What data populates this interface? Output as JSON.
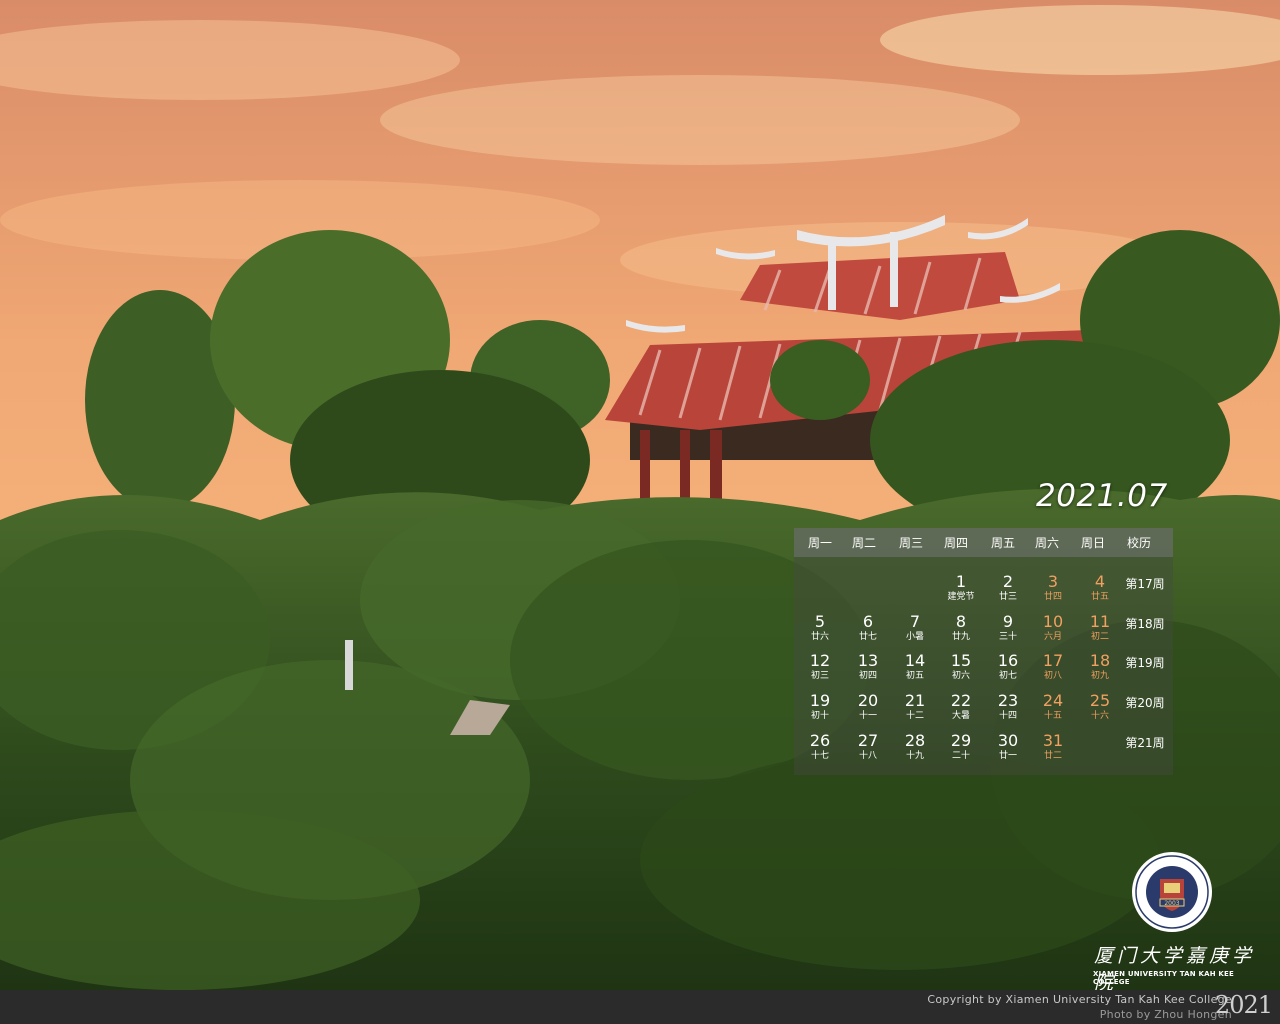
{
  "calendar": {
    "title": "2021.07",
    "weekdays": [
      "周一",
      "周二",
      "周三",
      "周四",
      "周五",
      "周六",
      "周日",
      "校历"
    ],
    "weeks": [
      {
        "label": "第17周",
        "days": [
          null,
          null,
          null,
          {
            "d": "1",
            "l": "建党节"
          },
          {
            "d": "2",
            "l": "廿三"
          },
          {
            "d": "3",
            "l": "廿四"
          },
          {
            "d": "4",
            "l": "廿五"
          }
        ]
      },
      {
        "label": "第18周",
        "days": [
          {
            "d": "5",
            "l": "廿六"
          },
          {
            "d": "6",
            "l": "廿七"
          },
          {
            "d": "7",
            "l": "小暑"
          },
          {
            "d": "8",
            "l": "廿九"
          },
          {
            "d": "9",
            "l": "三十"
          },
          {
            "d": "10",
            "l": "六月"
          },
          {
            "d": "11",
            "l": "初二"
          }
        ]
      },
      {
        "label": "第19周",
        "days": [
          {
            "d": "12",
            "l": "初三"
          },
          {
            "d": "13",
            "l": "初四"
          },
          {
            "d": "14",
            "l": "初五"
          },
          {
            "d": "15",
            "l": "初六"
          },
          {
            "d": "16",
            "l": "初七"
          },
          {
            "d": "17",
            "l": "初八"
          },
          {
            "d": "18",
            "l": "初九"
          }
        ]
      },
      {
        "label": "第20周",
        "days": [
          {
            "d": "19",
            "l": "初十"
          },
          {
            "d": "20",
            "l": "十一"
          },
          {
            "d": "21",
            "l": "十二"
          },
          {
            "d": "22",
            "l": "大暑"
          },
          {
            "d": "23",
            "l": "十四"
          },
          {
            "d": "24",
            "l": "十五"
          },
          {
            "d": "25",
            "l": "十六"
          }
        ]
      },
      {
        "label": "第21周",
        "days": [
          {
            "d": "26",
            "l": "十七"
          },
          {
            "d": "27",
            "l": "十八"
          },
          {
            "d": "28",
            "l": "十九"
          },
          {
            "d": "29",
            "l": "二十"
          },
          {
            "d": "30",
            "l": "廿一"
          },
          {
            "d": "31",
            "l": "廿二"
          },
          null
        ]
      }
    ]
  },
  "branding": {
    "logo_icon": "school-emblem-icon",
    "logo_year": "2003",
    "school_name_cn": "厦门大学嘉庚学院",
    "school_name_en": "XIAMEN UNIVERSITY TAN KAH KEE COLLEGE"
  },
  "footer": {
    "copyright": "Copyright by Xiamen University Tan Kah Kee College",
    "photo_credit": "Photo by Zhou Hongen",
    "year": "2021"
  },
  "colors": {
    "weekend": "#f0a060",
    "sky_top": "#e8a070",
    "sky_bottom": "#f6b27a",
    "pavilion": "#b8443a",
    "foliage": "#2f4a1e"
  }
}
